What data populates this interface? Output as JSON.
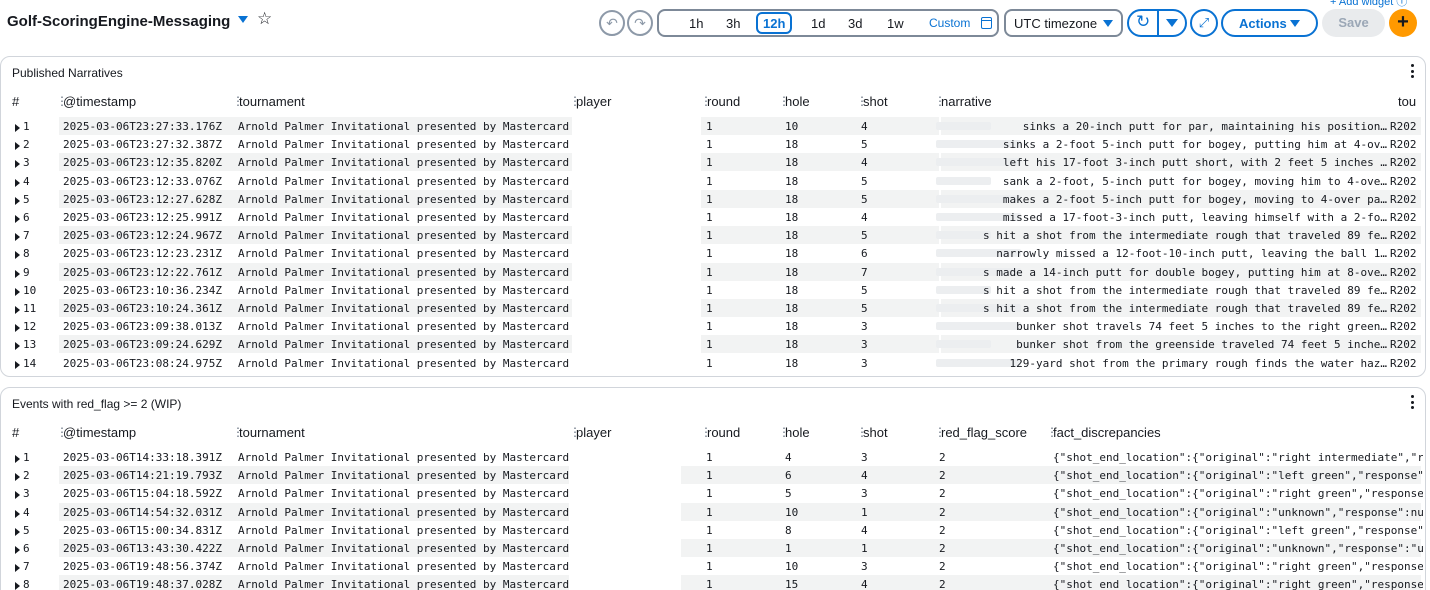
{
  "dashboard": {
    "title": "Golf-ScoringEngine-Messaging",
    "top_clipped_link": "+ Add widget ⓘ"
  },
  "time_range": {
    "options": [
      "1h",
      "3h",
      "12h",
      "1d",
      "3d",
      "1w"
    ],
    "selected": "12h",
    "custom_label": "Custom"
  },
  "toolbar": {
    "timezone": "UTC timezone",
    "actions_label": "Actions",
    "save_label": "Save",
    "add_label": "+"
  },
  "icons": {
    "undo": "undo-icon",
    "redo": "redo-icon",
    "refresh": "refresh-icon",
    "expand": "expand-icon",
    "calendar": "calendar-icon",
    "star": "star-icon"
  },
  "colors": {
    "accent": "#0972d3",
    "add_button": "#ff9900",
    "row_shade": "#f2f3f3"
  },
  "published_narratives": {
    "title": "Published Narratives",
    "columns": [
      "#",
      "@timestamp",
      "tournament",
      "player",
      "round",
      "hole",
      "shot",
      "narrative",
      "tou"
    ],
    "rows": [
      {
        "n": "1",
        "ts": "2025-03-06T23:27:33.176Z",
        "tournament": "Arnold Palmer Invitational presented by Mastercard",
        "round": "1",
        "hole": "10",
        "shot": "4",
        "narrative": "sinks a 20-inch putt for par, maintaining his position…",
        "tou": "R202"
      },
      {
        "n": "2",
        "ts": "2025-03-06T23:27:32.387Z",
        "tournament": "Arnold Palmer Invitational presented by Mastercard",
        "round": "1",
        "hole": "18",
        "shot": "5",
        "narrative": "sinks a 2-foot 5-inch putt for bogey, putting him at 4-ov…",
        "tou": "R202"
      },
      {
        "n": "3",
        "ts": "2025-03-06T23:12:35.820Z",
        "tournament": "Arnold Palmer Invitational presented by Mastercard",
        "round": "1",
        "hole": "18",
        "shot": "4",
        "narrative": "left his 17-foot 3-inch putt short, with 2 feet 5 inches …",
        "tou": "R202"
      },
      {
        "n": "4",
        "ts": "2025-03-06T23:12:33.076Z",
        "tournament": "Arnold Palmer Invitational presented by Mastercard",
        "round": "1",
        "hole": "18",
        "shot": "5",
        "narrative": "sank a 2-foot, 5-inch putt for bogey, moving him to 4-ove…",
        "tou": "R202"
      },
      {
        "n": "5",
        "ts": "2025-03-06T23:12:27.628Z",
        "tournament": "Arnold Palmer Invitational presented by Mastercard",
        "round": "1",
        "hole": "18",
        "shot": "5",
        "narrative": "makes a 2-foot 5-inch putt for bogey, moving to 4-over pa…",
        "tou": "R202"
      },
      {
        "n": "6",
        "ts": "2025-03-06T23:12:25.991Z",
        "tournament": "Arnold Palmer Invitational presented by Mastercard",
        "round": "1",
        "hole": "18",
        "shot": "4",
        "narrative": "missed a 17-foot-3-inch putt, leaving himself with a 2-fo…",
        "tou": "R202"
      },
      {
        "n": "7",
        "ts": "2025-03-06T23:12:24.967Z",
        "tournament": "Arnold Palmer Invitational presented by Mastercard",
        "round": "1",
        "hole": "18",
        "shot": "5",
        "narrative": "s hit a shot from the intermediate rough that traveled 89 fe…",
        "tou": "R202"
      },
      {
        "n": "8",
        "ts": "2025-03-06T23:12:23.231Z",
        "tournament": "Arnold Palmer Invitational presented by Mastercard",
        "round": "1",
        "hole": "18",
        "shot": "6",
        "narrative": "narrowly missed a 12-foot-10-inch putt, leaving the ball 1…",
        "tou": "R202"
      },
      {
        "n": "9",
        "ts": "2025-03-06T23:12:22.761Z",
        "tournament": "Arnold Palmer Invitational presented by Mastercard",
        "round": "1",
        "hole": "18",
        "shot": "7",
        "narrative": "s made a 14-inch putt for double bogey, putting him at 8-ove…",
        "tou": "R202"
      },
      {
        "n": "10",
        "ts": "2025-03-06T23:10:36.234Z",
        "tournament": "Arnold Palmer Invitational presented by Mastercard",
        "round": "1",
        "hole": "18",
        "shot": "5",
        "narrative": "s hit a shot from the intermediate rough that traveled 89 fe…",
        "tou": "R202"
      },
      {
        "n": "11",
        "ts": "2025-03-06T23:10:24.361Z",
        "tournament": "Arnold Palmer Invitational presented by Mastercard",
        "round": "1",
        "hole": "18",
        "shot": "5",
        "narrative": "s hit a shot from the intermediate rough that traveled 89 fe…",
        "tou": "R202"
      },
      {
        "n": "12",
        "ts": "2025-03-06T23:09:38.013Z",
        "tournament": "Arnold Palmer Invitational presented by Mastercard",
        "round": "1",
        "hole": "18",
        "shot": "3",
        "narrative": "bunker shot travels 74 feet 5 inches to the right green…",
        "tou": "R202"
      },
      {
        "n": "13",
        "ts": "2025-03-06T23:09:24.629Z",
        "tournament": "Arnold Palmer Invitational presented by Mastercard",
        "round": "1",
        "hole": "18",
        "shot": "3",
        "narrative": "bunker shot from the greenside traveled 74 feet 5 inche…",
        "tou": "R202"
      },
      {
        "n": "14",
        "ts": "2025-03-06T23:08:24.975Z",
        "tournament": "Arnold Palmer Invitational presented by Mastercard",
        "round": "1",
        "hole": "18",
        "shot": "3",
        "narrative": "129-yard shot from the primary rough finds the water haz…",
        "tou": "R202"
      }
    ]
  },
  "red_flag_events": {
    "title": "Events with red_flag >= 2 (WIP)",
    "columns": [
      "#",
      "@timestamp",
      "tournament",
      "player",
      "round",
      "hole",
      "shot",
      "red_flag_score",
      "fact_discrepancies"
    ],
    "rows": [
      {
        "n": "1",
        "ts": "2025-03-06T14:33:18.391Z",
        "tournament": "Arnold Palmer Invitational presented by Mastercard",
        "round": "1",
        "hole": "4",
        "shot": "3",
        "score": "2",
        "fd": "{\"shot_end_location\":{\"original\":\"right intermediate\",\"resp"
      },
      {
        "n": "2",
        "ts": "2025-03-06T14:21:19.793Z",
        "tournament": "Arnold Palmer Invitational presented by Mastercard",
        "round": "1",
        "hole": "6",
        "shot": "4",
        "score": "2",
        "fd": "{\"shot_end_location\":{\"original\":\"left green\",\"response\":\"j"
      },
      {
        "n": "3",
        "ts": "2025-03-06T15:04:18.592Z",
        "tournament": "Arnold Palmer Invitational presented by Mastercard",
        "round": "1",
        "hole": "5",
        "shot": "3",
        "score": "2",
        "fd": "{\"shot_end_location\":{\"original\":\"right green\",\"response\":\""
      },
      {
        "n": "4",
        "ts": "2025-03-06T14:54:32.031Z",
        "tournament": "Arnold Palmer Invitational presented by Mastercard",
        "round": "1",
        "hole": "10",
        "shot": "1",
        "score": "2",
        "fd": "{\"shot_end_location\":{\"original\":\"unknown\",\"response\":null}"
      },
      {
        "n": "5",
        "ts": "2025-03-06T15:00:34.831Z",
        "tournament": "Arnold Palmer Invitational presented by Mastercard",
        "round": "1",
        "hole": "8",
        "shot": "4",
        "score": "2",
        "fd": "{\"shot_end_location\":{\"original\":\"left green\",\"response\":\"g"
      },
      {
        "n": "6",
        "ts": "2025-03-06T13:43:30.422Z",
        "tournament": "Arnold Palmer Invitational presented by Mastercard",
        "round": "1",
        "hole": "1",
        "shot": "1",
        "score": "2",
        "fd": "{\"shot_end_location\":{\"original\":\"unknown\",\"response\":\"unkn"
      },
      {
        "n": "7",
        "ts": "2025-03-06T19:48:56.374Z",
        "tournament": "Arnold Palmer Invitational presented by Mastercard",
        "round": "1",
        "hole": "10",
        "shot": "3",
        "score": "2",
        "fd": "{\"shot_end_location\":{\"original\":\"right green\",\"response\":\""
      },
      {
        "n": "8",
        "ts": "2025-03-06T19:48:37.028Z",
        "tournament": "Arnold Palmer Invitational presented by Mastercard",
        "round": "1",
        "hole": "15",
        "shot": "4",
        "score": "2",
        "fd": "{\"shot_end_location\":{\"original\":\"right green\",\"response\":\""
      }
    ]
  }
}
